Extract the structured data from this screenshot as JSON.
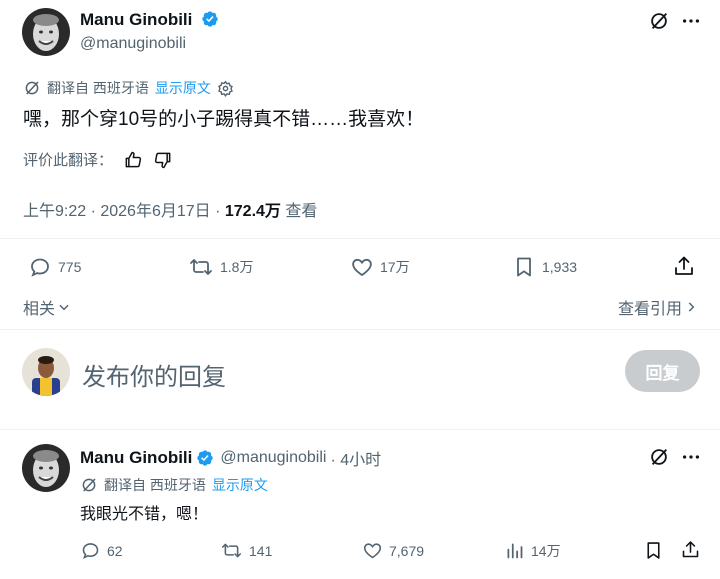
{
  "tweet": {
    "author_name": "Manu Ginobili",
    "author_handle": "@manuginobili",
    "translated_from": "翻译自 西班牙语",
    "show_original": "显示原文",
    "text": "嘿，那个穿10号的小子踢得真不错……我喜欢！",
    "rate_translation": "评价此翻译：",
    "timestamp": "上午9:22 · 2026年6月17日 · ",
    "views_count": "172.4万",
    "views_label": " 查看",
    "stats": {
      "replies": "775",
      "retweets": "1.8万",
      "likes": "17万",
      "bookmarks": "1,933"
    },
    "related_label": "相关",
    "view_quotes": "查看引用"
  },
  "reply_box": {
    "placeholder": "发布你的回复",
    "button_label": "回复"
  },
  "reply": {
    "author_name": "Manu Ginobili",
    "author_handle": "@manuginobili",
    "time": "· 4小时",
    "translated_from": "翻译自 西班牙语",
    "show_original": "显示原文",
    "text": "我眼光不错，嗯！",
    "stats": {
      "replies": "62",
      "retweets": "141",
      "likes": "7,679",
      "views": "14万"
    }
  },
  "colors": {
    "verified": "#1d9bf0",
    "link": "#1d9bf0",
    "muted": "#536471",
    "reply_button_disabled": "#c8cccf"
  }
}
